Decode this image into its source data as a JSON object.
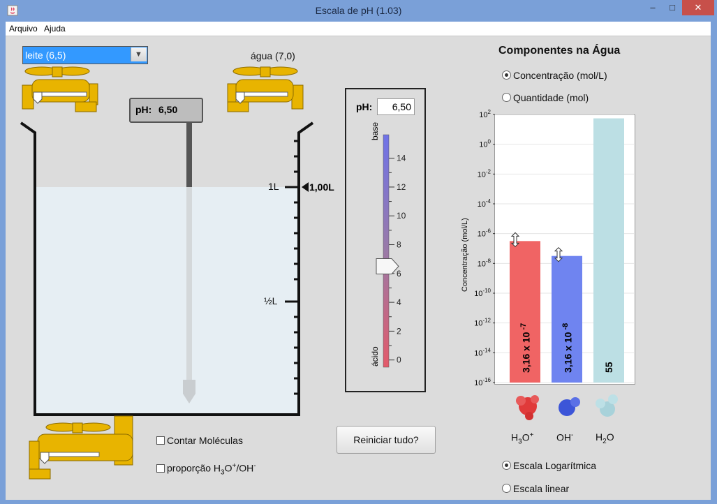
{
  "window": {
    "title": "Escala de pH (1.03)",
    "min": "–",
    "max": "□",
    "close": "✕"
  },
  "menu": {
    "items": [
      "Arquivo",
      "Ajuda"
    ]
  },
  "solution": {
    "selected": "leite (6,5)",
    "water_label": "água (7,0)"
  },
  "meter": {
    "label": "pH:",
    "value": "6,50"
  },
  "beaker": {
    "mark_1l": "1L",
    "mark_half": "½L",
    "volume": "1,00L",
    "fill_level_l": 1.0
  },
  "slider": {
    "ph_label": "pH:",
    "ph_value": "6,50",
    "ticks": [
      "14",
      "12",
      "10",
      "8",
      "6",
      "4",
      "2",
      "0"
    ],
    "base_label": "base",
    "acid_label": "ácido",
    "value": 6.5
  },
  "options": {
    "count_molecules": "Contar Moléculas",
    "ratio_prefix": "proporção H",
    "ratio_sub3": "3",
    "ratio_o": "O",
    "ratio_sup_plus": "+",
    "ratio_oh": "/OH",
    "ratio_sup_minus": "-"
  },
  "reset_button": "Reiniciar tudo?",
  "components": {
    "title": "Componentes na Água",
    "radio_concentration": "Concentração (mol/L)",
    "radio_quantity": "Quantidade (mol)",
    "radio_log": "Escala Logarítmica",
    "radio_linear": "Escala linear",
    "molecule_labels": {
      "h3o": {
        "a": "H",
        "b": "3",
        "c": "O",
        "d": "+"
      },
      "oh": {
        "a": "OH",
        "d": "-"
      },
      "h2o": {
        "a": "H",
        "b": "2",
        "c": "O"
      }
    }
  },
  "chart_data": {
    "type": "bar",
    "scale": "log",
    "ylabel": "Concentração (mol/L)",
    "ylim_exp": [
      -16,
      2
    ],
    "ytick_exponents": [
      2,
      0,
      -2,
      -4,
      -6,
      -8,
      -10,
      -12,
      -14,
      -16
    ],
    "tick_base": "10",
    "categories": [
      "H3O+",
      "OH-",
      "H2O"
    ],
    "values": [
      3.16e-07,
      3.16e-08,
      55
    ],
    "value_labels": [
      {
        "main": "3,16 x 10",
        "exp": "-7"
      },
      {
        "main": "3,16 x 10",
        "exp": "-8"
      },
      {
        "main": "55",
        "exp": ""
      }
    ],
    "colors": [
      "#f06464",
      "#6f84f0",
      "#bcdfe4"
    ]
  }
}
